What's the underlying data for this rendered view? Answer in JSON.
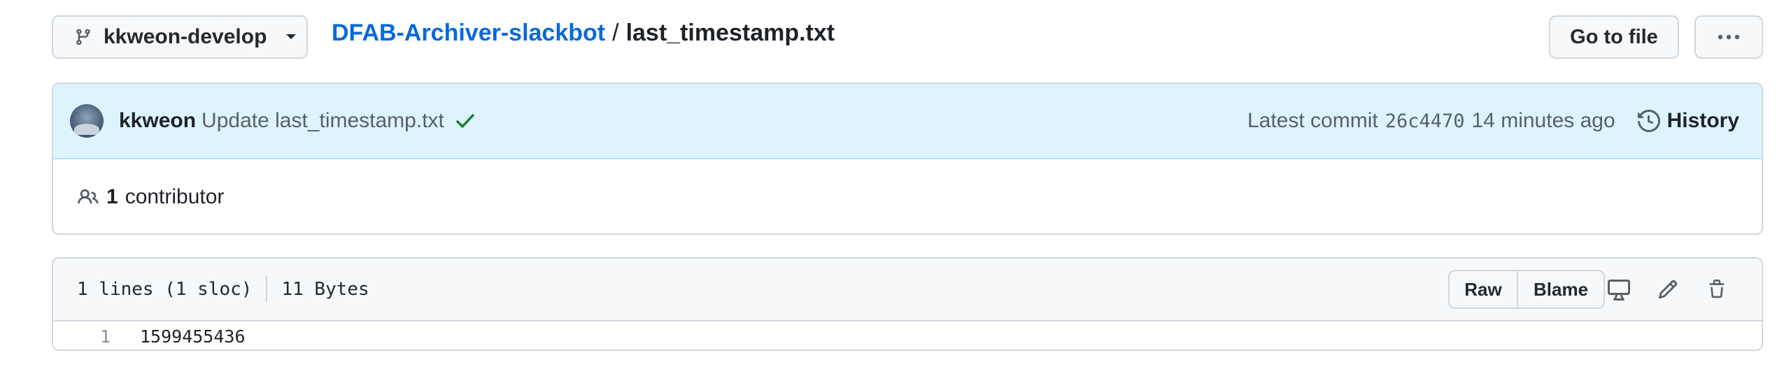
{
  "branch": {
    "name": "kkweon-develop",
    "icon": "git-branch-icon"
  },
  "breadcrumb": {
    "repo": "DFAB-Archiver-slackbot",
    "separator": "/",
    "file": "last_timestamp.txt"
  },
  "actions": {
    "go_to_file": "Go to file",
    "more_icon": "kebab-horizontal-icon"
  },
  "commit": {
    "author": "kkweon",
    "message": "Update last_timestamp.txt",
    "status": "success",
    "latest_label": "Latest commit",
    "sha": "26c4470",
    "time": "14 minutes ago",
    "history_label": "History"
  },
  "contributors": {
    "count": "1",
    "label": "contributor"
  },
  "file": {
    "lines": "1 lines (1 sloc)",
    "size": "11 Bytes",
    "raw_label": "Raw",
    "blame_label": "Blame",
    "code": [
      {
        "num": "1",
        "text": "1599455436"
      }
    ]
  },
  "colors": {
    "link": "#0969da",
    "success": "#1a7f37",
    "commit_bg": "#ddf4ff",
    "border": "#d0d7de"
  }
}
